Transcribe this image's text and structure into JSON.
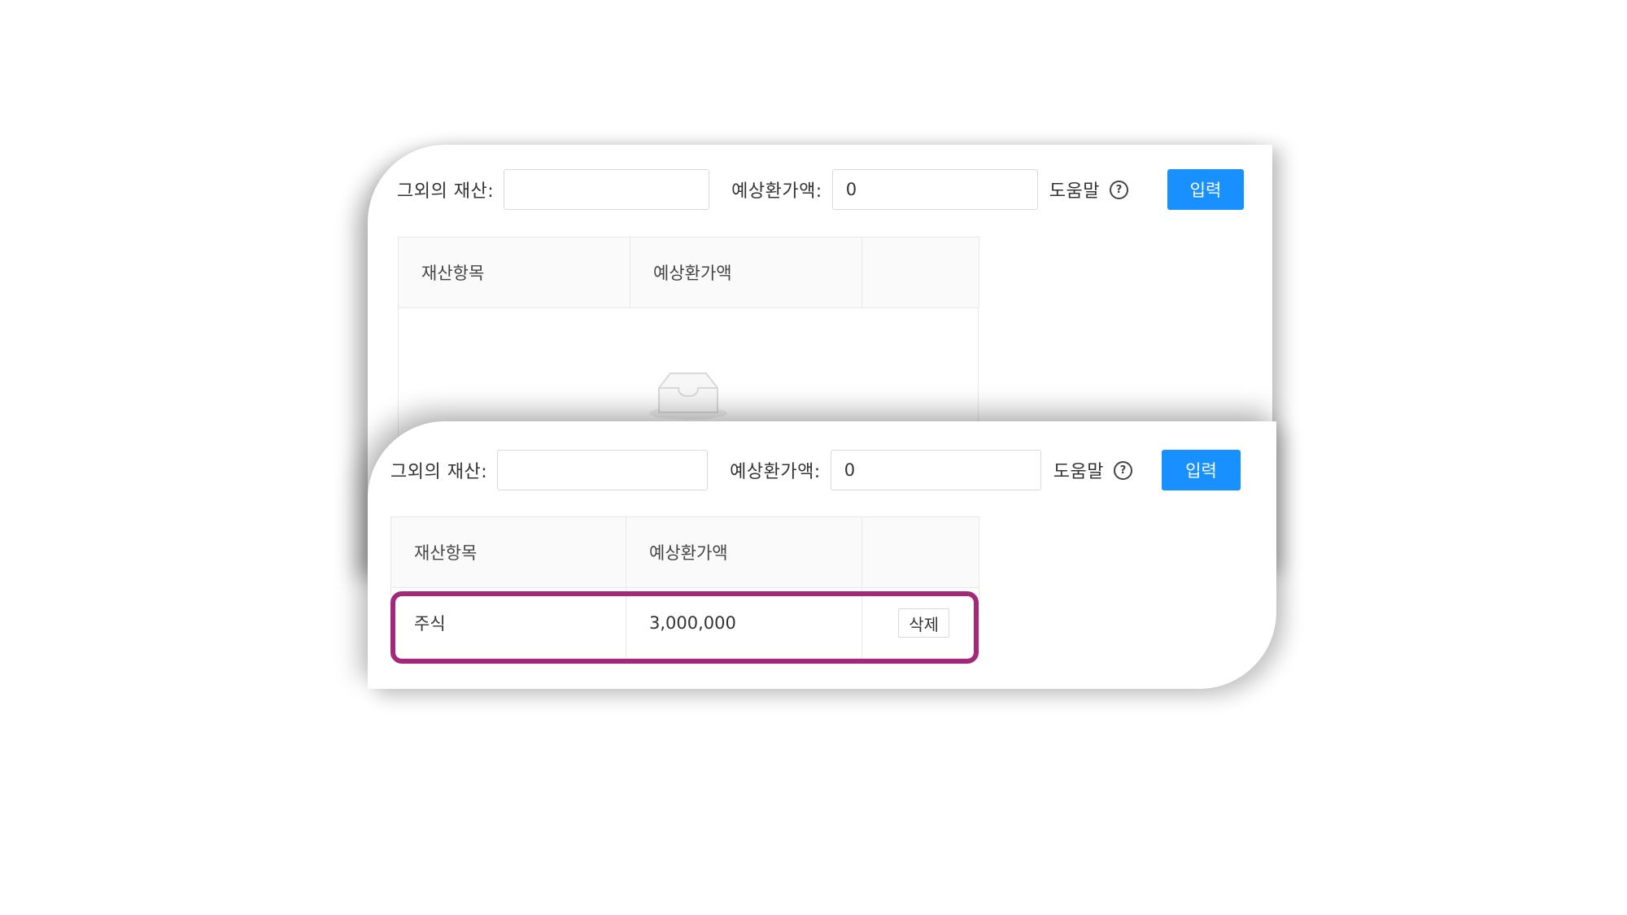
{
  "colors": {
    "primary": "#1890ff",
    "highlight": "#a4287a",
    "border": "#d9d9d9",
    "header_bg": "#fafafa"
  },
  "top_panel": {
    "other_asset_label": "그외의 재산:",
    "other_asset_value": "",
    "estimated_value_label": "예상환가액:",
    "estimated_value_value": "0",
    "help_label": "도움말",
    "help_icon": "question-circle-icon",
    "submit_label": "입력",
    "table": {
      "headers": [
        "재산항목",
        "예상환가액",
        ""
      ],
      "rows": [],
      "empty_icon": "empty-inbox-icon"
    }
  },
  "bottom_panel": {
    "other_asset_label": "그외의 재산:",
    "other_asset_value": "",
    "estimated_value_label": "예상환가액:",
    "estimated_value_value": "0",
    "help_label": "도움말",
    "help_icon": "question-circle-icon",
    "submit_label": "입력",
    "table": {
      "headers": [
        "재산항목",
        "예상환가액",
        ""
      ],
      "rows": [
        {
          "item": "주식",
          "amount": "3,000,000",
          "action": "삭제"
        }
      ]
    }
  }
}
